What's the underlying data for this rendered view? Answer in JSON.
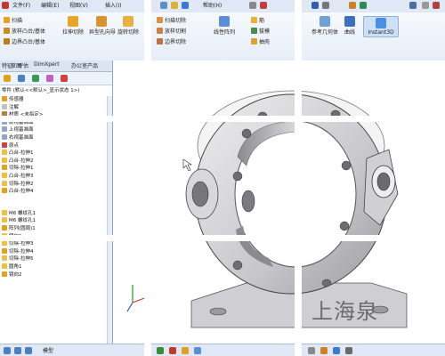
{
  "menubar": {
    "items": [
      "文件(F)",
      "编辑(E)",
      "视图(V)",
      "插入(I)",
      "帮助(H)"
    ]
  },
  "ribbon": {
    "buttons": [
      {
        "label": "扫描",
        "icon": "sweep-icon"
      },
      {
        "label": "拉伸切除",
        "icon": "extrude-cut-icon"
      },
      {
        "label": "异型孔向导",
        "icon": "hole-wizard-icon"
      },
      {
        "label": "旋转切除",
        "icon": "revolve-cut-icon"
      },
      {
        "label": "线性阵列",
        "icon": "linear-pattern-icon"
      },
      {
        "label": "参考几何体",
        "icon": "reference-geometry-icon"
      },
      {
        "label": "曲线",
        "icon": "curves-icon"
      },
      {
        "label": "Instant3D",
        "icon": "instant3d-icon"
      }
    ],
    "small_items": [
      "扫描",
      "放样凸台/基体",
      "边界凸台/基体",
      "扫描切除",
      "放样切割",
      "边界切除",
      "筋",
      "拔模",
      "抽壳"
    ]
  },
  "left_panel": {
    "tabs": [
      "特征",
      "草图",
      "评估",
      "DimXpert",
      "办公室产品"
    ],
    "filter_label": "零件 (默认<<默认>_显示状态 1>)",
    "tree_items": [
      "传感器",
      "注解",
      "材质 <未指定>",
      "前视基准面",
      "上视基准面",
      "右视基准面",
      "原点",
      "凸台-拉伸1",
      "凸台-拉伸2",
      "切除-拉伸1",
      "凸台-拉伸3",
      "切除-拉伸2",
      "凸台-拉伸4",
      "M6 螺纹孔1",
      "M6 螺纹孔1",
      "阵列(圆周)1",
      "镜向1",
      "切除-拉伸3",
      "切除-拉伸4",
      "切除-拉伸5",
      "圆角1",
      "镜向2"
    ]
  },
  "bottom": {
    "tab_label": "模型"
  },
  "watermark": "上海泉",
  "colors": {
    "ribbon_bg": "#e6eef8",
    "panel_border": "#8da6c7",
    "part_gray": "#c8c8cc",
    "accent_orange": "#f0a020"
  }
}
